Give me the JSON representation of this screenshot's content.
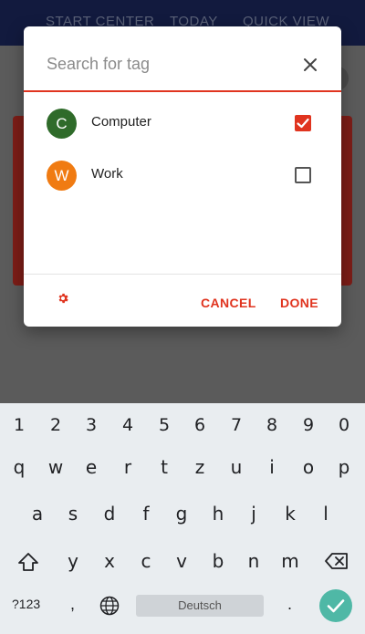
{
  "app": {
    "tabs": [
      "START CENTER",
      "TODAY",
      "QUICK VIEW"
    ]
  },
  "dialog": {
    "search_placeholder": "Search for tag",
    "tags": [
      {
        "letter": "C",
        "label": "Computer",
        "color": "#2f6b2a",
        "checked": true
      },
      {
        "letter": "W",
        "label": "Work",
        "color": "#f07b12",
        "checked": false
      }
    ],
    "cancel_label": "CANCEL",
    "done_label": "DONE",
    "accent_color": "#e0341f"
  },
  "keyboard": {
    "numbers": [
      "1",
      "2",
      "3",
      "4",
      "5",
      "6",
      "7",
      "8",
      "9",
      "0"
    ],
    "row1": [
      "q",
      "w",
      "e",
      "r",
      "t",
      "z",
      "u",
      "i",
      "o",
      "p"
    ],
    "row2": [
      "a",
      "s",
      "d",
      "f",
      "g",
      "h",
      "j",
      "k",
      "l"
    ],
    "row3": [
      "y",
      "x",
      "c",
      "v",
      "b",
      "n",
      "m"
    ],
    "symbols_key": "?123",
    "comma_key": ",",
    "space_label": "Deutsch",
    "period_key": ".",
    "enter_color": "#4fb8a6"
  }
}
